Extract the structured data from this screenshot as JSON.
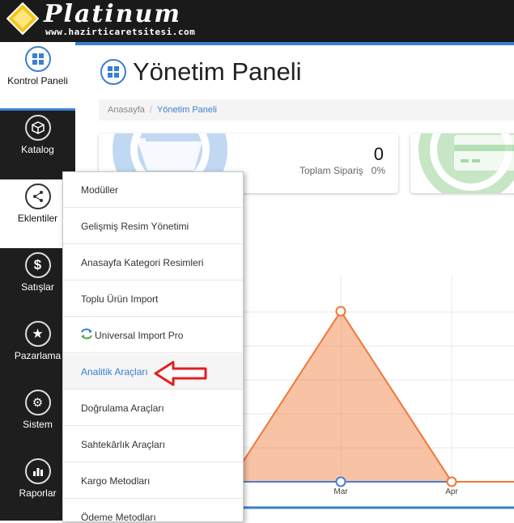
{
  "header": {
    "logo_text": "Platinum",
    "logo_sub": "www.hazirticaretsitesi.com"
  },
  "sidebar": {
    "items": [
      {
        "label": "Kontrol Paneli",
        "icon": "dashboard-icon",
        "state": "active"
      },
      {
        "label": "Katalog",
        "icon": "cube-icon",
        "state": "normal"
      },
      {
        "label": "Eklentiler",
        "icon": "share-icon",
        "state": "hover"
      },
      {
        "label": "Satışlar",
        "icon": "dollar-icon",
        "state": "normal"
      },
      {
        "label": "Pazarlama",
        "icon": "star-icon",
        "state": "normal"
      },
      {
        "label": "Sistem",
        "icon": "gears-icon",
        "state": "normal"
      },
      {
        "label": "Raporlar",
        "icon": "bar-chart-icon",
        "state": "normal"
      }
    ]
  },
  "page": {
    "title": "Yönetim Paneli",
    "breadcrumb": [
      "Anasayfa",
      "Yönetim Paneli"
    ]
  },
  "cards": [
    {
      "count": "0",
      "label": "Toplam Sipariş",
      "percent": "0%",
      "icon": "shopping-cart-icon",
      "color": "#4a90d9"
    },
    {
      "icon": "credit-card-icon",
      "color": "#5cb85c"
    }
  ],
  "menu": {
    "items": [
      {
        "label": "Modüller"
      },
      {
        "label": "Gelişmiş Resim Yönetimi"
      },
      {
        "label": "Anasayfa Kategori Resimleri"
      },
      {
        "label": "Toplu Ürün Import"
      },
      {
        "label": "Universal Import Pro",
        "icon": "sync-icon"
      },
      {
        "label": "Analitik Araçları",
        "highlighted": true
      },
      {
        "label": "Doğrulama Araçları"
      },
      {
        "label": "Sahtekârlık Araçları"
      },
      {
        "label": "Kargo Metodları"
      },
      {
        "label": "Ödeme Metodları"
      }
    ]
  },
  "chart_data": {
    "type": "area",
    "categories": [
      "Mar",
      "Apr"
    ],
    "series": [
      {
        "color": "#f07838",
        "points": [
          {
            "x": "Mar",
            "y": 1
          },
          {
            "x": "Apr",
            "y": 0
          }
        ]
      },
      {
        "color": "#4a7fd0",
        "points": [
          {
            "x": "Mar",
            "y": 0
          }
        ]
      }
    ]
  },
  "colors": {
    "accent": "#3a7fd0",
    "sidebar_bg": "#1e1e1e",
    "arrow": "#e02020"
  }
}
